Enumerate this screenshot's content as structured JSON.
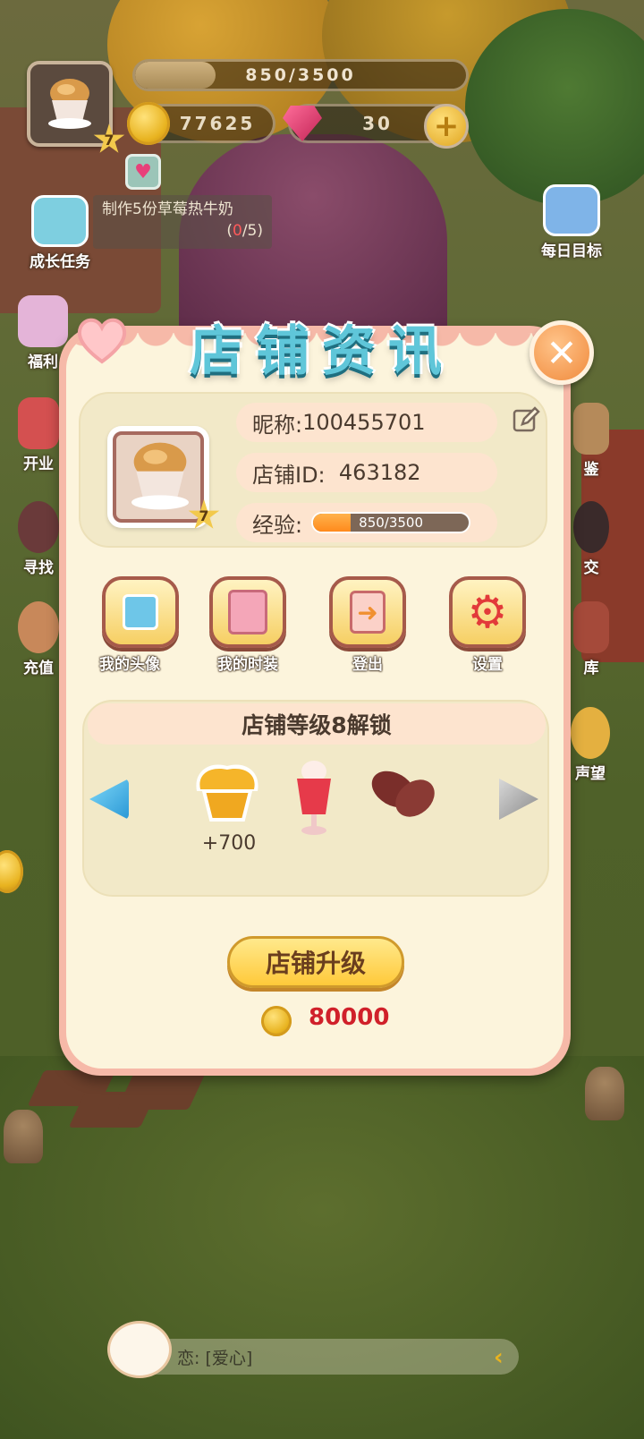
{
  "hud": {
    "level": "7",
    "exp_text": "850/3500",
    "exp_fraction": 0.243,
    "coins": "77625",
    "gems": "30"
  },
  "side_left": [
    {
      "label": "成长任务"
    },
    {
      "label": "福利"
    },
    {
      "label": "开业"
    },
    {
      "label": "寻找"
    },
    {
      "label": "充值"
    }
  ],
  "side_right": [
    {
      "label": "每日目标"
    },
    {
      "label": "鉴"
    },
    {
      "label": "交"
    },
    {
      "label": "库"
    },
    {
      "label": "声望"
    }
  ],
  "task": {
    "text": "制作5份草莓热牛奶",
    "progress_open": "(",
    "progress_done": "0",
    "progress_rest": "/5)"
  },
  "dialog": {
    "title": "店铺资讯",
    "avatar_level": "7",
    "nickname_label": "昵称: ",
    "nickname": "100455701",
    "shop_id_label": "店铺ID:  ",
    "shop_id": "463182",
    "exp_label": "经验:",
    "exp_text": "850/3500",
    "exp_fraction": 0.243,
    "menu": [
      {
        "label": "我的头像",
        "icon": "avatar-icon"
      },
      {
        "label": "我的时装",
        "icon": "wardrobe-icon"
      },
      {
        "label": "登出",
        "icon": "logout-icon"
      },
      {
        "label": "设置",
        "icon": "settings-gear-icon"
      }
    ],
    "unlock_title": "店铺等级8解锁",
    "rewards": [
      {
        "icon": "muffin-reward-icon",
        "label": "+700"
      },
      {
        "icon": "strawberry-drink-icon",
        "label": ""
      },
      {
        "icon": "cocoa-beans-icon",
        "label": ""
      }
    ],
    "upgrade_label": "店铺升级",
    "upgrade_cost": "80000"
  },
  "chat": {
    "text": "恋: [爱心]"
  },
  "colors": {
    "title": "#5fc6d9",
    "dialog_border": "#f6b9a8",
    "dialog_bg": "#fcf4dc",
    "cost": "#d0202a"
  }
}
